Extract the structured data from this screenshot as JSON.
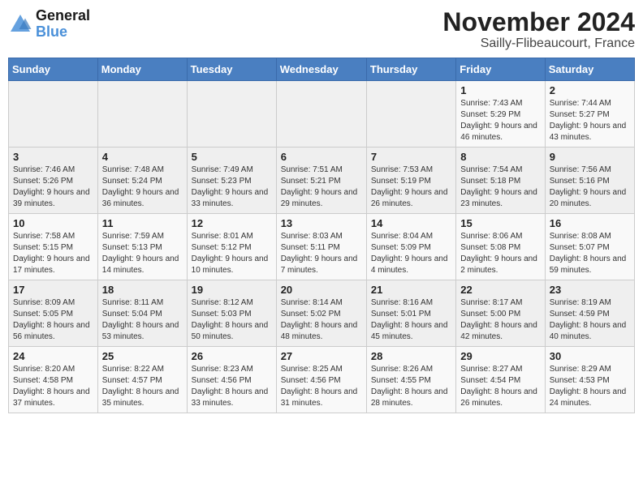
{
  "header": {
    "logo_text_general": "General",
    "logo_text_blue": "Blue",
    "title": "November 2024",
    "subtitle": "Sailly-Flibeaucourt, France"
  },
  "days_of_week": [
    "Sunday",
    "Monday",
    "Tuesday",
    "Wednesday",
    "Thursday",
    "Friday",
    "Saturday"
  ],
  "weeks": [
    [
      {
        "day": "",
        "info": ""
      },
      {
        "day": "",
        "info": ""
      },
      {
        "day": "",
        "info": ""
      },
      {
        "day": "",
        "info": ""
      },
      {
        "day": "",
        "info": ""
      },
      {
        "day": "1",
        "info": "Sunrise: 7:43 AM\nSunset: 5:29 PM\nDaylight: 9 hours and 46 minutes."
      },
      {
        "day": "2",
        "info": "Sunrise: 7:44 AM\nSunset: 5:27 PM\nDaylight: 9 hours and 43 minutes."
      }
    ],
    [
      {
        "day": "3",
        "info": "Sunrise: 7:46 AM\nSunset: 5:26 PM\nDaylight: 9 hours and 39 minutes."
      },
      {
        "day": "4",
        "info": "Sunrise: 7:48 AM\nSunset: 5:24 PM\nDaylight: 9 hours and 36 minutes."
      },
      {
        "day": "5",
        "info": "Sunrise: 7:49 AM\nSunset: 5:23 PM\nDaylight: 9 hours and 33 minutes."
      },
      {
        "day": "6",
        "info": "Sunrise: 7:51 AM\nSunset: 5:21 PM\nDaylight: 9 hours and 29 minutes."
      },
      {
        "day": "7",
        "info": "Sunrise: 7:53 AM\nSunset: 5:19 PM\nDaylight: 9 hours and 26 minutes."
      },
      {
        "day": "8",
        "info": "Sunrise: 7:54 AM\nSunset: 5:18 PM\nDaylight: 9 hours and 23 minutes."
      },
      {
        "day": "9",
        "info": "Sunrise: 7:56 AM\nSunset: 5:16 PM\nDaylight: 9 hours and 20 minutes."
      }
    ],
    [
      {
        "day": "10",
        "info": "Sunrise: 7:58 AM\nSunset: 5:15 PM\nDaylight: 9 hours and 17 minutes."
      },
      {
        "day": "11",
        "info": "Sunrise: 7:59 AM\nSunset: 5:13 PM\nDaylight: 9 hours and 14 minutes."
      },
      {
        "day": "12",
        "info": "Sunrise: 8:01 AM\nSunset: 5:12 PM\nDaylight: 9 hours and 10 minutes."
      },
      {
        "day": "13",
        "info": "Sunrise: 8:03 AM\nSunset: 5:11 PM\nDaylight: 9 hours and 7 minutes."
      },
      {
        "day": "14",
        "info": "Sunrise: 8:04 AM\nSunset: 5:09 PM\nDaylight: 9 hours and 4 minutes."
      },
      {
        "day": "15",
        "info": "Sunrise: 8:06 AM\nSunset: 5:08 PM\nDaylight: 9 hours and 2 minutes."
      },
      {
        "day": "16",
        "info": "Sunrise: 8:08 AM\nSunset: 5:07 PM\nDaylight: 8 hours and 59 minutes."
      }
    ],
    [
      {
        "day": "17",
        "info": "Sunrise: 8:09 AM\nSunset: 5:05 PM\nDaylight: 8 hours and 56 minutes."
      },
      {
        "day": "18",
        "info": "Sunrise: 8:11 AM\nSunset: 5:04 PM\nDaylight: 8 hours and 53 minutes."
      },
      {
        "day": "19",
        "info": "Sunrise: 8:12 AM\nSunset: 5:03 PM\nDaylight: 8 hours and 50 minutes."
      },
      {
        "day": "20",
        "info": "Sunrise: 8:14 AM\nSunset: 5:02 PM\nDaylight: 8 hours and 48 minutes."
      },
      {
        "day": "21",
        "info": "Sunrise: 8:16 AM\nSunset: 5:01 PM\nDaylight: 8 hours and 45 minutes."
      },
      {
        "day": "22",
        "info": "Sunrise: 8:17 AM\nSunset: 5:00 PM\nDaylight: 8 hours and 42 minutes."
      },
      {
        "day": "23",
        "info": "Sunrise: 8:19 AM\nSunset: 4:59 PM\nDaylight: 8 hours and 40 minutes."
      }
    ],
    [
      {
        "day": "24",
        "info": "Sunrise: 8:20 AM\nSunset: 4:58 PM\nDaylight: 8 hours and 37 minutes."
      },
      {
        "day": "25",
        "info": "Sunrise: 8:22 AM\nSunset: 4:57 PM\nDaylight: 8 hours and 35 minutes."
      },
      {
        "day": "26",
        "info": "Sunrise: 8:23 AM\nSunset: 4:56 PM\nDaylight: 8 hours and 33 minutes."
      },
      {
        "day": "27",
        "info": "Sunrise: 8:25 AM\nSunset: 4:56 PM\nDaylight: 8 hours and 31 minutes."
      },
      {
        "day": "28",
        "info": "Sunrise: 8:26 AM\nSunset: 4:55 PM\nDaylight: 8 hours and 28 minutes."
      },
      {
        "day": "29",
        "info": "Sunrise: 8:27 AM\nSunset: 4:54 PM\nDaylight: 8 hours and 26 minutes."
      },
      {
        "day": "30",
        "info": "Sunrise: 8:29 AM\nSunset: 4:53 PM\nDaylight: 8 hours and 24 minutes."
      }
    ]
  ]
}
